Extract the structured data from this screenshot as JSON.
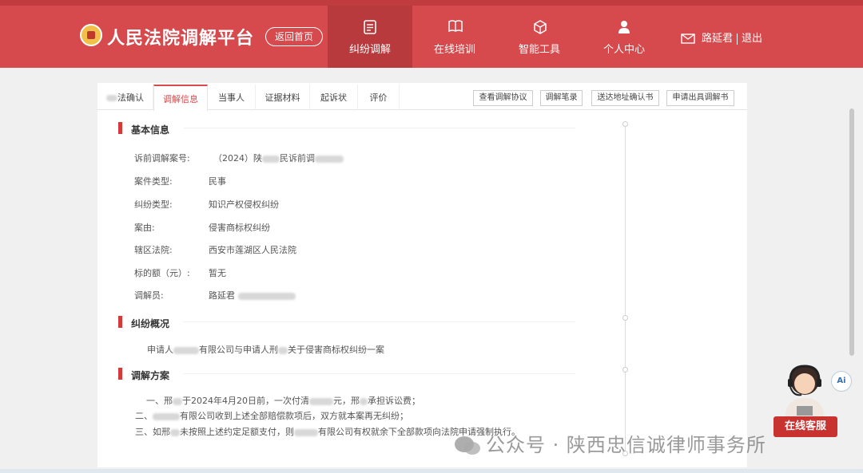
{
  "header": {
    "app_title": "人民法院调解平台",
    "home_button": "返回首页",
    "nav": [
      {
        "label": "纠纷调解",
        "icon": "document-icon",
        "active": true
      },
      {
        "label": "在线培训",
        "icon": "book-icon"
      },
      {
        "label": "智能工具",
        "icon": "cube-icon"
      },
      {
        "label": "个人中心",
        "icon": "person-icon"
      }
    ],
    "user_name": "路延君",
    "logout": "退出",
    "brand_color": "#d64a4d"
  },
  "tabs": [
    {
      "label": "法确认"
    },
    {
      "label": "调解信息",
      "active": true
    },
    {
      "label": "当事人"
    },
    {
      "label": "证据材料"
    },
    {
      "label": "起诉状"
    },
    {
      "label": "评价"
    }
  ],
  "actions": [
    "查看调解协议",
    "调解笔录",
    "送达地址确认书",
    "申请出具调解书"
  ],
  "basic_info": {
    "section_title": "基本信息",
    "rows": [
      {
        "label": "诉前调解案号:",
        "value": "（2024）陕",
        "value_mid": "民诉前调"
      },
      {
        "label": "案件类型:",
        "value": "民事"
      },
      {
        "label": "纠纷类型:",
        "value": "知识产权侵权纠纷"
      },
      {
        "label": "案由:",
        "value": "侵害商标权纠纷"
      },
      {
        "label": "辖区法院:",
        "value": "西安市莲湖区人民法院"
      },
      {
        "label": "标的额（元）:",
        "value": "暂无"
      },
      {
        "label": "调解员:",
        "value": "路延君"
      }
    ]
  },
  "overview": {
    "section_title": "纠纷概况",
    "text_a": "申请人",
    "text_b": "有限公司与申请人刑",
    "text_c": "关于侵害商标权纠纷一案"
  },
  "plan": {
    "section_title": "调解方案",
    "line1_a": "一、邢",
    "line1_b": "于2024年4月20日前，一次付清",
    "line1_c": "元，邢",
    "line1_d": "承担诉讼费；",
    "line2_a": "二、",
    "line2_b": "有限公司收到上述全部赔偿款项后，双方就本案再无纠纷；",
    "line3_a": "三、如邢",
    "line3_b": "未按照上述约定足额支付，则",
    "line3_c": "有限公司有权就余下全部款项向法院申请强制执行。"
  },
  "widgets": {
    "ai_label": "Ai",
    "service_label": "在线客服"
  },
  "watermark": "公众号 · 陕西忠信诚律师事务所"
}
